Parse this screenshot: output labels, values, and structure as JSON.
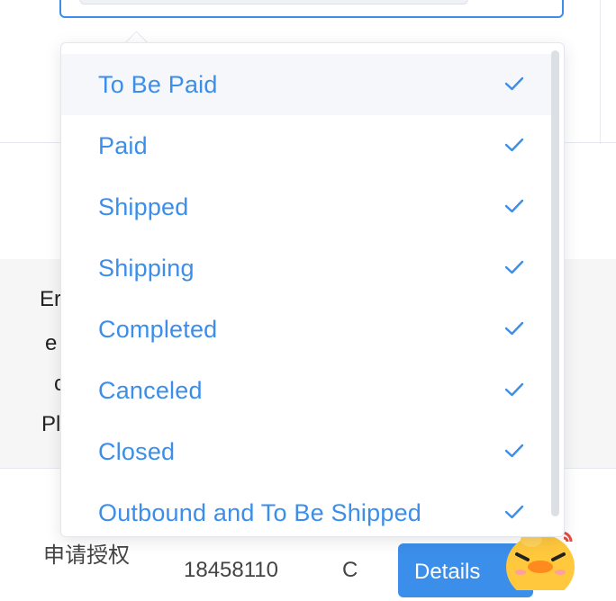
{
  "background": {
    "table_header_fragments": [
      "Er",
      "e",
      "c",
      "Pl"
    ],
    "row_text": "申请授权",
    "row_number": "18458110",
    "row_prefix_1": "C",
    "details_button_label": "Details"
  },
  "dropdown": {
    "options": [
      {
        "label": "To Be Paid",
        "selected": true,
        "hovered": true
      },
      {
        "label": "Paid",
        "selected": true
      },
      {
        "label": "Shipped",
        "selected": true
      },
      {
        "label": "Shipping",
        "selected": true
      },
      {
        "label": "Completed",
        "selected": true
      },
      {
        "label": "Canceled",
        "selected": true
      },
      {
        "label": "Closed",
        "selected": true
      },
      {
        "label": "Outbound and To Be Shipped",
        "selected": true
      }
    ]
  },
  "colors": {
    "accent": "#3b8eea",
    "hover_bg": "#f5f7fa",
    "header_bg": "#f6f6f6"
  },
  "icons": {
    "check": "check-icon",
    "mascot": "duck-mascot-icon"
  }
}
